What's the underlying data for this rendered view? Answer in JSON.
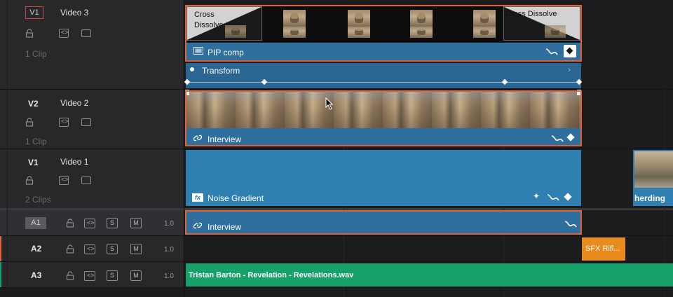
{
  "tracks": {
    "v3": {
      "id": "V1",
      "name": "Video 3",
      "clips": "1 Clip"
    },
    "v2": {
      "id": "V2",
      "name": "Video 2",
      "clips": "1 Clip"
    },
    "v1": {
      "id": "V1",
      "name": "Video 1",
      "clips": "2 Clips"
    },
    "a1": {
      "id": "A1",
      "solo": "S",
      "mute": "M",
      "volume": "1.0"
    },
    "a2": {
      "id": "A2",
      "solo": "S",
      "mute": "M",
      "volume": "1.0"
    },
    "a3": {
      "id": "A3",
      "solo": "S",
      "mute": "M",
      "volume": "1.0"
    }
  },
  "clips": {
    "cross_dissolve_left": "Cross Dissolve",
    "cross_dissolve_right": "Cross Dissolve",
    "pip": "PIP comp",
    "transform": "Transform",
    "interview_video": "Interview",
    "noise_gradient": "Noise Gradient",
    "herding": "herding",
    "interview_audio": "Interview",
    "sfx": "SFX Rifl...",
    "music": "Tristan Barton - Revelation - Revelations.wav"
  },
  "colors": {
    "accent_border": "#e0623a",
    "video_clip": "#2f6f9e",
    "audio_green": "#16a06a",
    "sfx_orange": "#e98a1d"
  },
  "icons": [
    "lock-icon",
    "auto-select-icon",
    "monitor-icon",
    "link-icon",
    "fx-icon",
    "keyframe-icon",
    "curve-icon",
    "sparkle-icon"
  ]
}
